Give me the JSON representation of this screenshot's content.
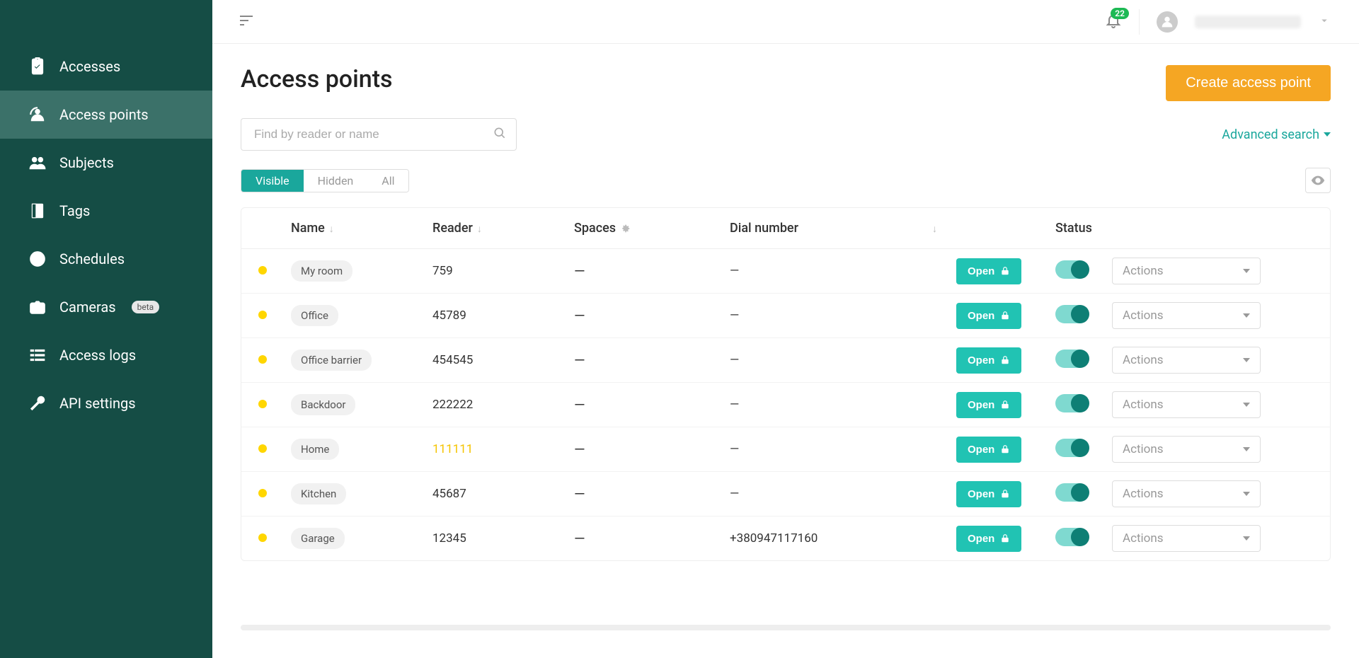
{
  "sidebar": {
    "items": [
      {
        "label": "Accesses"
      },
      {
        "label": "Access points"
      },
      {
        "label": "Subjects"
      },
      {
        "label": "Tags"
      },
      {
        "label": "Schedules"
      },
      {
        "label": "Cameras",
        "badge": "beta"
      },
      {
        "label": "Access logs"
      },
      {
        "label": "API settings"
      }
    ]
  },
  "header": {
    "notification_count": "22"
  },
  "page": {
    "title": "Access points",
    "create_btn": "Create access point",
    "search_placeholder": "Find by reader or name",
    "advanced_search": "Advanced search"
  },
  "filters": {
    "visible": "Visible",
    "hidden": "Hidden",
    "all": "All"
  },
  "table": {
    "headers": {
      "name": "Name",
      "reader": "Reader",
      "spaces": "Spaces",
      "dial": "Dial number",
      "status": "Status"
    },
    "open_label": "Open",
    "actions_label": "Actions",
    "rows": [
      {
        "name": "My room",
        "reader": "759",
        "spaces": "—",
        "dial": "—"
      },
      {
        "name": "Office",
        "reader": "45789",
        "spaces": "—",
        "dial": "—"
      },
      {
        "name": "Office barrier",
        "reader": "454545",
        "spaces": "—",
        "dial": "—"
      },
      {
        "name": "Backdoor",
        "reader": "222222",
        "spaces": "—",
        "dial": "—"
      },
      {
        "name": "Home",
        "reader": "111111",
        "spaces": "—",
        "dial": "—"
      },
      {
        "name": "Kitchen",
        "reader": "45687",
        "spaces": "—",
        "dial": "—"
      },
      {
        "name": "Garage",
        "reader": "12345",
        "spaces": "—",
        "dial": "+380947117160"
      }
    ]
  }
}
